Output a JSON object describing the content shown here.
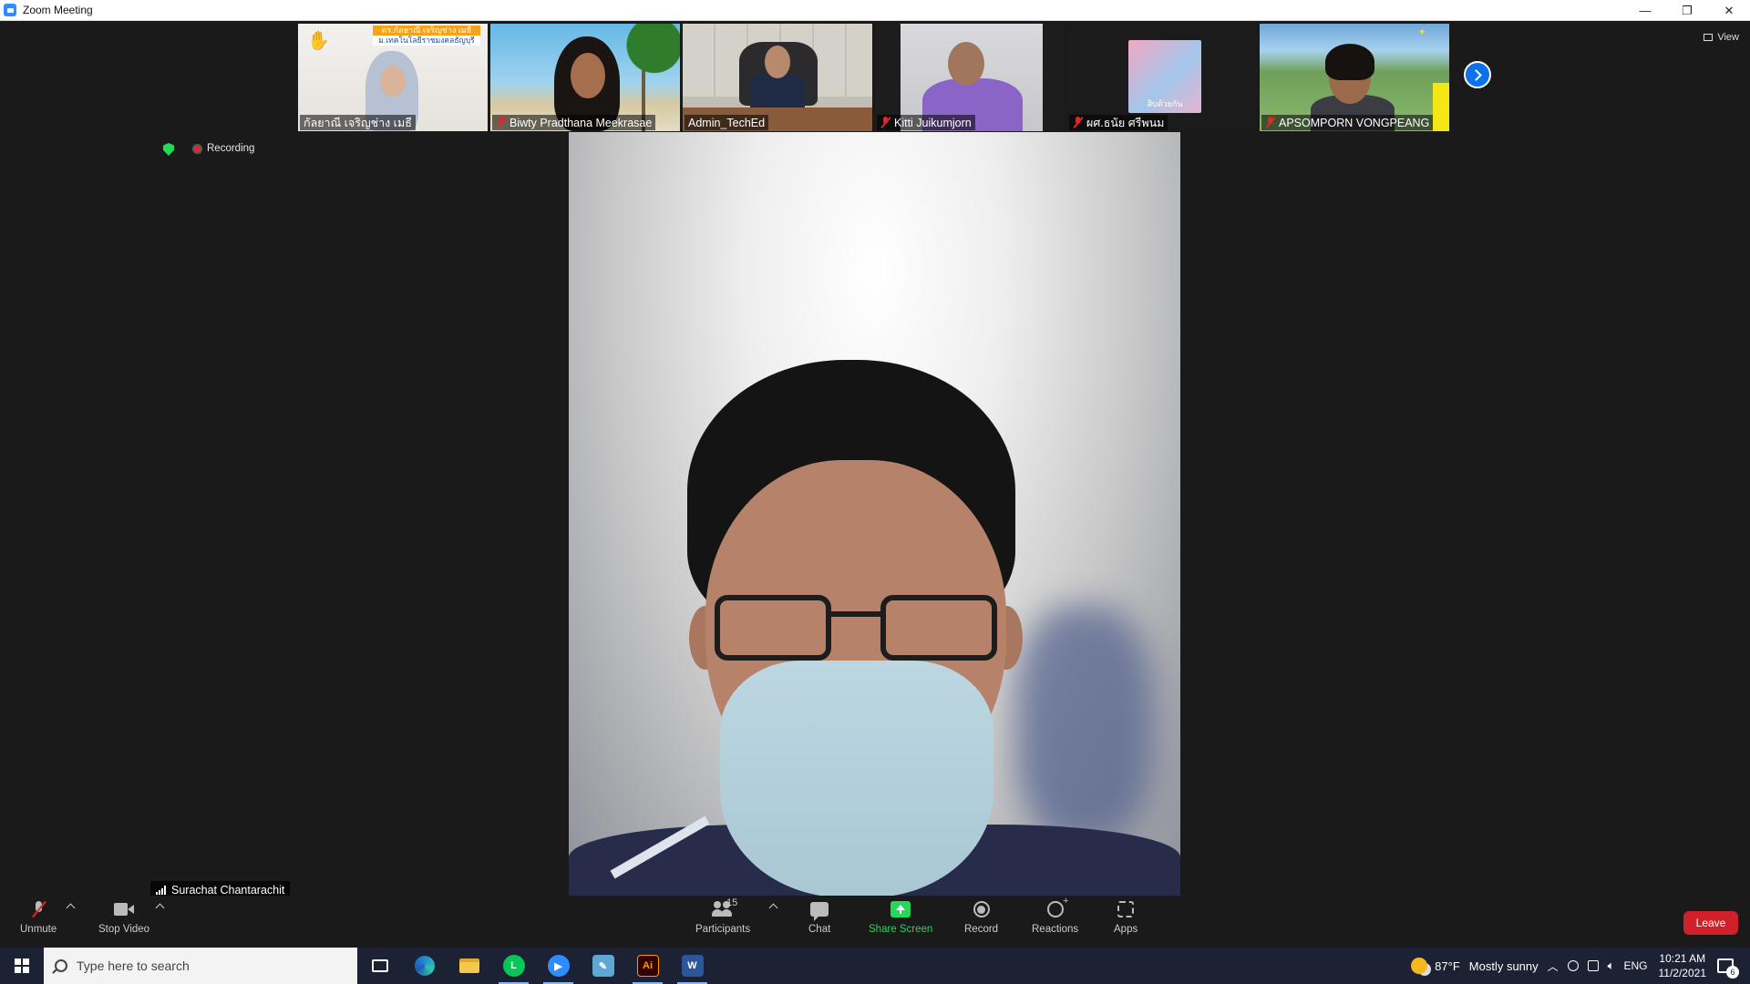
{
  "window": {
    "title": "Zoom Meeting",
    "controls": [
      "minimize",
      "restore",
      "close"
    ]
  },
  "meeting": {
    "view_label": "View",
    "recording_label": "Recording",
    "active_speaker": "Surachat Chantarachit",
    "thumbnails": [
      {
        "name": "กัลยาณี เจริญช่าง เมธี",
        "muted": false,
        "hand_raised": true,
        "banner_top": "ดร.กัลยาณี เจริญช่าง เมธี",
        "banner_bottom": "ม.เทคโนโลยีราชมงคลธัญบุรี"
      },
      {
        "name": "Biwty Pradthana Meekrasae",
        "muted": true
      },
      {
        "name": "Admin_TechEd",
        "muted": false
      },
      {
        "name": "Kitti Juikumjorn",
        "muted": true
      },
      {
        "name": "ผศ.ธนัย ศรีพนม",
        "muted": true,
        "poster_text": "สิบด้วยกัน"
      },
      {
        "name": "APSOMPORN VONGPEANG",
        "muted": true
      }
    ]
  },
  "toolbar": {
    "unmute": "Unmute",
    "stop_video": "Stop Video",
    "participants": "Participants",
    "participant_count": "15",
    "chat": "Chat",
    "share_screen": "Share Screen",
    "record": "Record",
    "reactions": "Reactions",
    "apps": "Apps",
    "leave": "Leave"
  },
  "taskbar": {
    "search_placeholder": "Type here to search",
    "weather_temp": "87°F",
    "weather_desc": "Mostly sunny",
    "language": "ENG",
    "time": "10:21 AM",
    "date": "11/2/2021",
    "notification_count": "6",
    "apps": [
      "task-view",
      "edge",
      "file-explorer",
      "line",
      "zoom",
      "notepad",
      "illustrator",
      "word"
    ]
  },
  "colors": {
    "zoom_blue": "#2d8cff",
    "share_green": "#23d959",
    "leave_red": "#d0202a",
    "muted_red": "#e02828",
    "toolbar_bg": "#1a1a1a",
    "taskbar_bg": "#1c2233"
  }
}
